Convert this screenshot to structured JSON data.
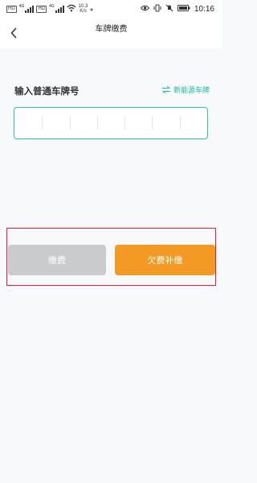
{
  "status_bar": {
    "sim_1": "HD",
    "sim_2": "HD",
    "net_1": "4G",
    "net_2": "4G",
    "speed_value": "10.3",
    "speed_unit": "K/s",
    "time": "10:16"
  },
  "nav": {
    "title": "车牌缴费"
  },
  "form": {
    "label": "输入普通车牌号",
    "switch_label": "新能源车牌",
    "accent_color": "#2ec3a1"
  },
  "actions": {
    "pay_label": "缴费",
    "arrears_label": "欠费补缴",
    "pay_color": "#c9cbcc",
    "arrears_color": "#f39a24",
    "highlight_color": "#e61e34"
  }
}
